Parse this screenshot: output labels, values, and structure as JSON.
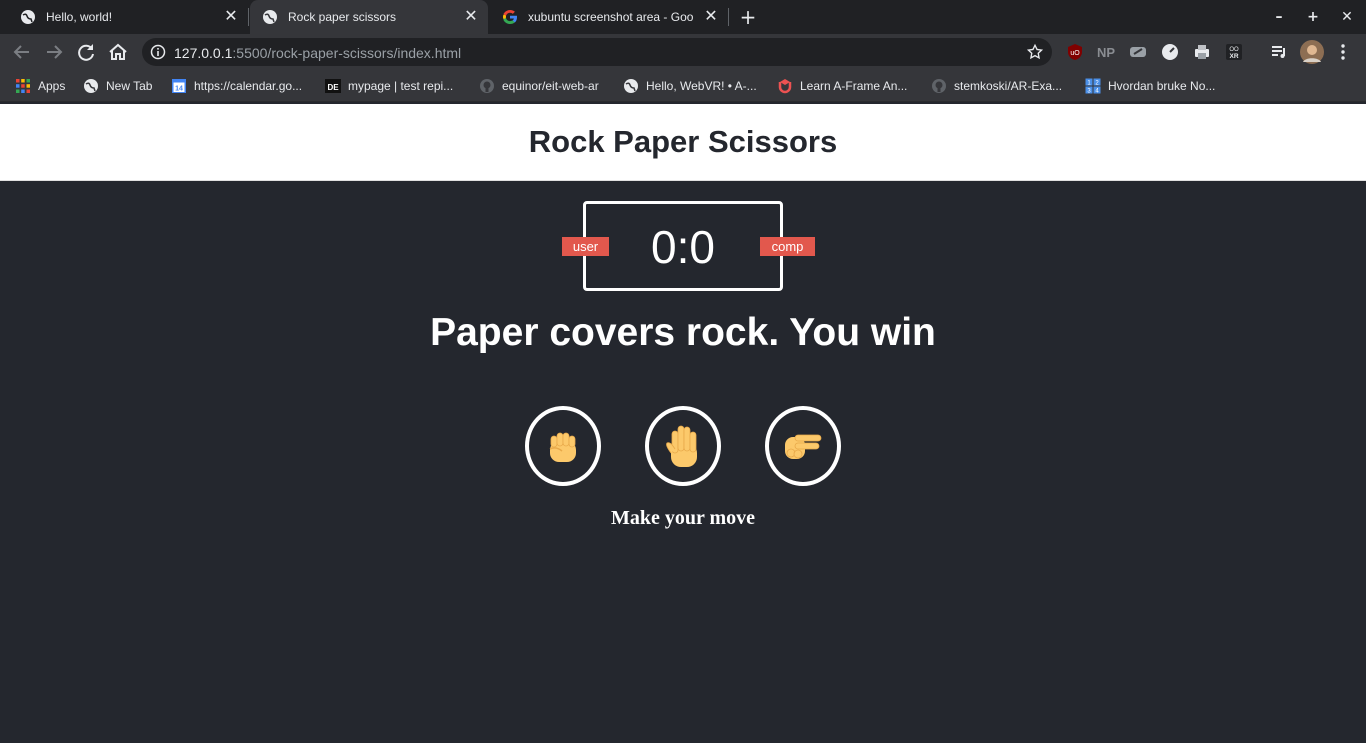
{
  "browser": {
    "tabs": [
      {
        "title": "Hello, world!",
        "active": false
      },
      {
        "title": "Rock paper scissors",
        "active": true
      },
      {
        "title": "xubuntu screenshot area - Goo",
        "active": false
      }
    ],
    "url_host": "127.0.0.1",
    "url_rest": ":5500/rock-paper-scissors/index.html",
    "bookmarks": [
      {
        "label": "Apps",
        "icon": "apps-grid-icon"
      },
      {
        "label": "New Tab",
        "icon": "globe-icon"
      },
      {
        "label": "https://calendar.go...",
        "icon": "calendar-icon"
      },
      {
        "label": "mypage | test repi...",
        "icon": "de-icon"
      },
      {
        "label": "equinor/eit-web-ar",
        "icon": "github-icon"
      },
      {
        "label": "Hello, WebVR! • A-...",
        "icon": "globe-icon"
      },
      {
        "label": "Learn A-Frame An...",
        "icon": "udemy-icon"
      },
      {
        "label": "stemkoski/AR-Exa...",
        "icon": "github-icon"
      },
      {
        "label": "Hvordan bruke No...",
        "icon": "numbers-icon"
      }
    ],
    "extensions": [
      "ublock-icon",
      "np-icon",
      "gamepad-icon",
      "speed-icon",
      "printer-icon",
      "webxr-icon",
      "media-queue-icon",
      "avatar"
    ]
  },
  "app": {
    "title": "Rock Paper Scissors",
    "score": "0:0",
    "user_label": "user",
    "comp_label": "comp",
    "result": "Paper covers rock. You win",
    "choices": [
      {
        "name": "rock",
        "icon": "raised-fist-hand-icon"
      },
      {
        "name": "paper",
        "icon": "raised-hand-icon"
      },
      {
        "name": "scissors",
        "icon": "victory-hand-icon"
      }
    ],
    "prompt": "Make your move"
  },
  "colors": {
    "background": "#24272e",
    "badge": "#e2584d",
    "hand": "#fcc96b"
  }
}
